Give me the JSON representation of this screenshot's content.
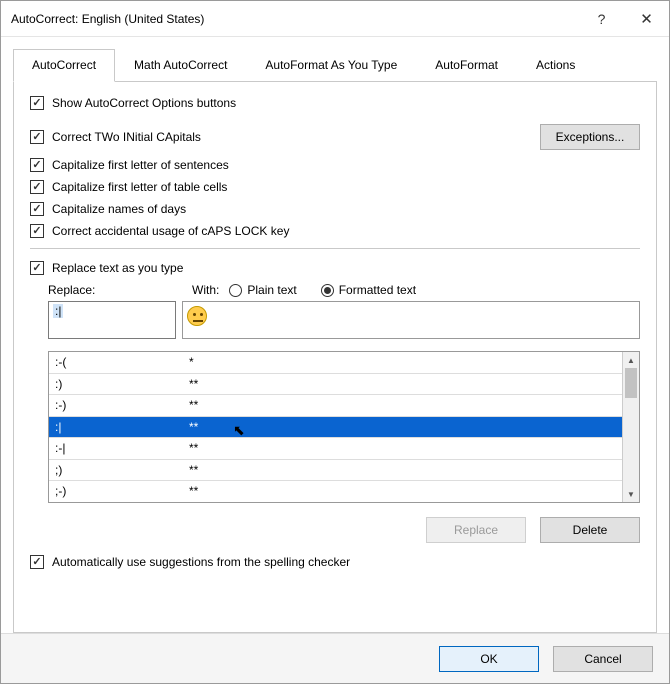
{
  "title": "AutoCorrect: English (United States)",
  "tabs": [
    "AutoCorrect",
    "Math AutoCorrect",
    "AutoFormat As You Type",
    "AutoFormat",
    "Actions"
  ],
  "active_tab": 0,
  "options": {
    "show_buttons": "Show AutoCorrect Options buttons",
    "two_initial": "Correct TWo INitial CApitals",
    "sentences": "Capitalize first letter of sentences",
    "cells": "Capitalize first letter of table cells",
    "days": "Capitalize names of days",
    "caps_lock": "Correct accidental usage of cAPS LOCK key",
    "replace_as_type": "Replace text as you type",
    "auto_suggest": "Automatically use suggestions from the spelling checker"
  },
  "exceptions_label": "Exceptions...",
  "replace_label": "Replace:",
  "with_label": "With:",
  "radio_plain": "Plain text",
  "radio_formatted": "Formatted text",
  "formatted_selected": true,
  "replace_value": ":|",
  "with_value_icon": "neutral-face-emoji",
  "list": [
    {
      "r": ":-(",
      "w": "*"
    },
    {
      "r": ":)",
      "w": "**"
    },
    {
      "r": ":-)",
      "w": "**"
    },
    {
      "r": ":|",
      "w": "**",
      "selected": true
    },
    {
      "r": ":-|",
      "w": "**"
    },
    {
      "r": ";)",
      "w": "**"
    },
    {
      "r": ";-)",
      "w": "**"
    }
  ],
  "buttons": {
    "replace": "Replace",
    "delete": "Delete",
    "ok": "OK",
    "cancel": "Cancel"
  }
}
